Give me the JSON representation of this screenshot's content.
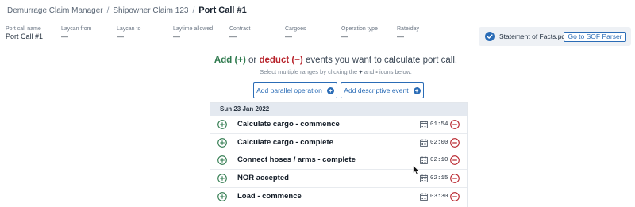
{
  "breadcrumb": {
    "items": [
      "Demurrage Claim Manager",
      "Shipowner Claim 123"
    ],
    "current": "Port Call #1",
    "separator": "/"
  },
  "summary": {
    "fields": [
      {
        "label": "Port call name",
        "value": "Port Call #1"
      },
      {
        "label": "Laycan from",
        "value": "—"
      },
      {
        "label": "Laycan to",
        "value": "—"
      },
      {
        "label": "Laytime allowed",
        "value": "—"
      },
      {
        "label": "Contract",
        "value": "—"
      },
      {
        "label": "Cargoes",
        "value": "—"
      },
      {
        "label": "Operation type",
        "value": "—"
      },
      {
        "label": "Rate/day",
        "value": "—"
      }
    ]
  },
  "sof": {
    "file_name": "Statement of Facts.pdf",
    "button_label": "Go to SOF Parser",
    "status_icon": "check-badge-icon"
  },
  "intro": {
    "add_word": "Add",
    "plus_token": "(+)",
    "or_word": "or",
    "deduct_word": "deduct",
    "minus_token": "(−)",
    "rest": "events you want to calculate port call.",
    "hint_prefix": "Select multiple ranges by clicking the",
    "hint_plus": "+",
    "hint_and": "and",
    "hint_minus": "-",
    "hint_suffix": "icons below."
  },
  "actions": {
    "add_parallel_label": "Add parallel operation",
    "add_descriptive_label": "Add descriptive event"
  },
  "events_group": {
    "date": "Sun 23 Jan 2022",
    "events": [
      {
        "name": "Calculate cargo - commence",
        "time": "01:54"
      },
      {
        "name": "Calculate cargo - complete",
        "time": "02:00"
      },
      {
        "name": "Connect hoses / arms - complete",
        "time": "02:10"
      },
      {
        "name": "NOR accepted",
        "time": "02:15"
      },
      {
        "name": "Load - commence",
        "time": "03:30"
      }
    ]
  },
  "colors": {
    "accent_blue": "#2a6cb6",
    "add_green": "#2f7a4e",
    "deduct_red": "#b8242c",
    "date_header_bg": "#e4e9f0"
  }
}
